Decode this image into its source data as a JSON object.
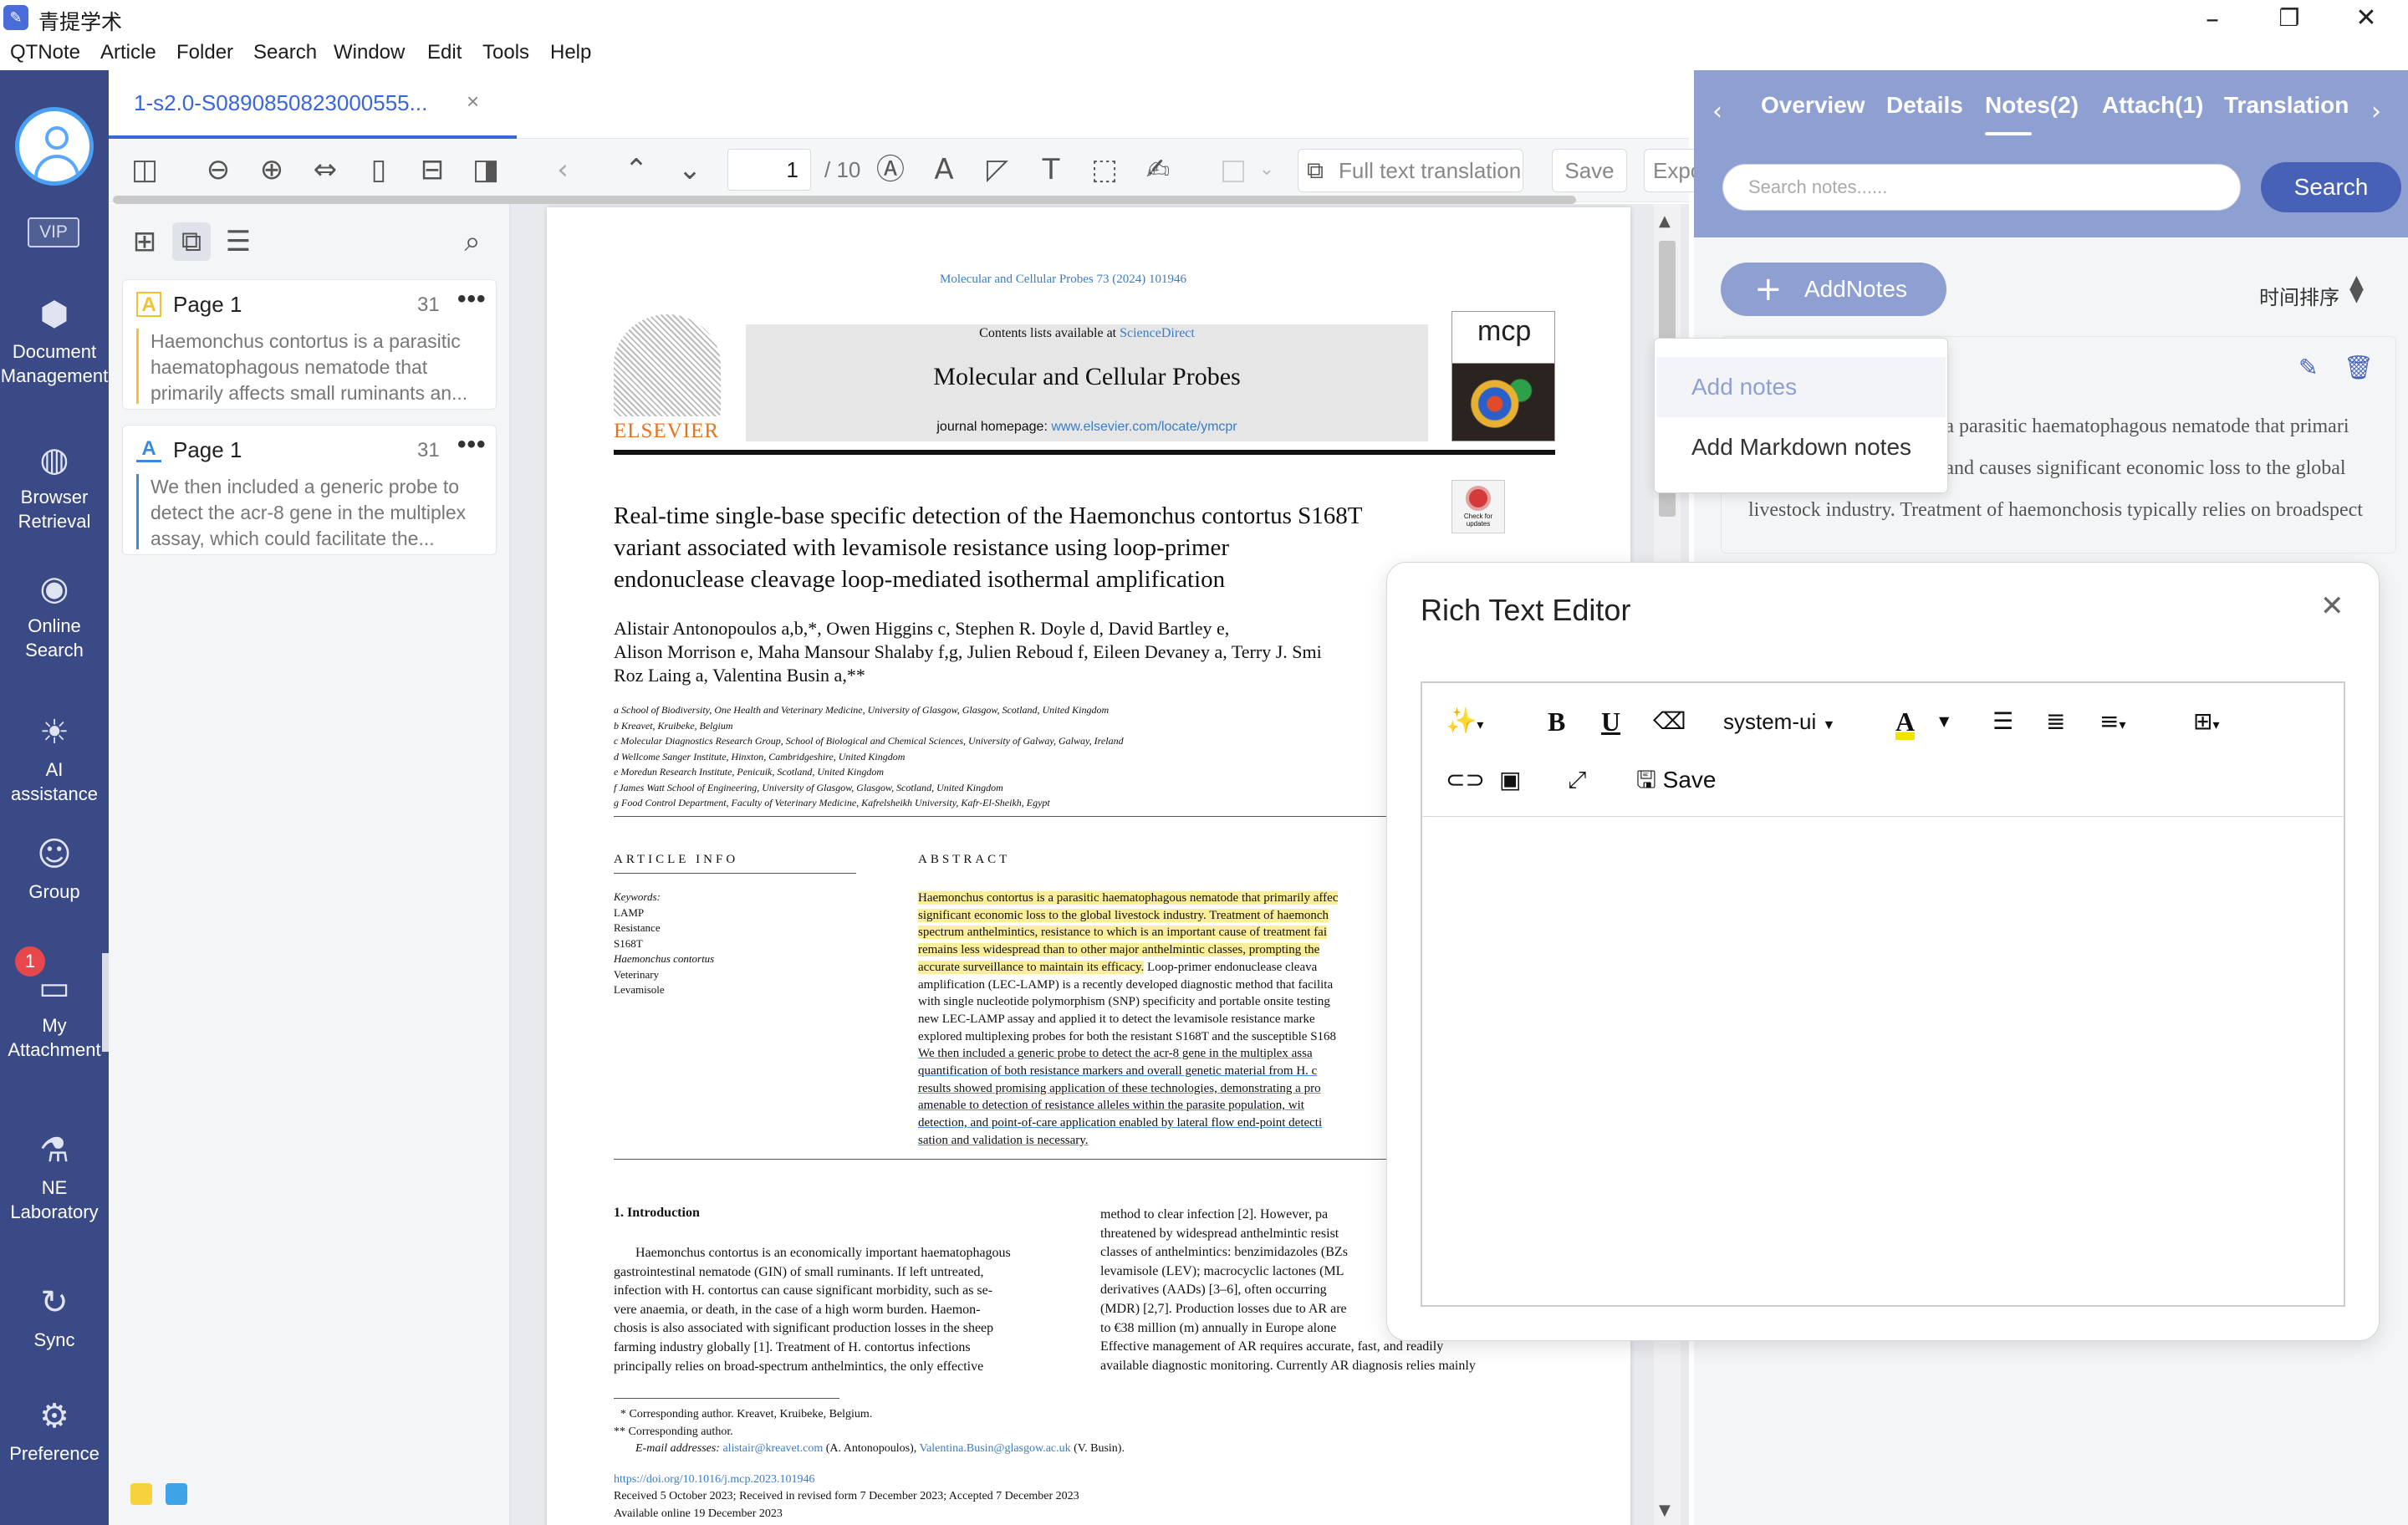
{
  "app": {
    "title": "青提学术",
    "logo_icon": "app-logo-icon",
    "window_controls": {
      "minimize": "–",
      "restore": "❐",
      "close": "✕"
    }
  },
  "menu": [
    "QTNote",
    "Article",
    "Folder",
    "Search",
    "Window",
    "Edit",
    "Tools",
    "Help"
  ],
  "nav": {
    "vip": "VIP",
    "items": [
      {
        "label_lines": [
          "Document",
          "Management"
        ],
        "icon": "cube-icon"
      },
      {
        "label_lines": [
          "Browser",
          "Retrieval"
        ],
        "icon": "globe-icon"
      },
      {
        "label_lines": [
          "Online",
          "Search"
        ],
        "icon": "eye-icon"
      },
      {
        "label_lines": [
          "AI assistance"
        ],
        "icon": "bulb-icon"
      },
      {
        "label_lines": [
          "Group"
        ],
        "icon": "group-icon"
      },
      {
        "label_lines": [
          "My",
          "Attachment"
        ],
        "icon": "folder-icon"
      },
      {
        "label_lines": [
          "NE",
          "Laboratory"
        ],
        "icon": "microscope-icon"
      },
      {
        "label_lines": [
          "Sync"
        ],
        "icon": "sync-icon"
      },
      {
        "label_lines": [
          "Preference"
        ],
        "icon": "gear-icon"
      }
    ],
    "attachment_badge": "1"
  },
  "doc_tab": {
    "label": "1-s2.0-S0890850823000555...",
    "close": "×"
  },
  "toolbar": {
    "page_current": "1",
    "page_total": "/ 10",
    "full_text_translation": "Full text translation",
    "save": "Save",
    "export": "Expo"
  },
  "annotations": [
    {
      "type": "highlight",
      "page": "Page 1",
      "count": "31",
      "more": "•••",
      "color": "#f2c230",
      "text": "Haemonchus contortus is a parasitic haematophagous nematode that primarily affects small ruminants an..."
    },
    {
      "type": "underline",
      "page": "Page 1",
      "count": "31",
      "more": "•••",
      "color": "#3a88e0",
      "text": "We then included a generic probe to detect the acr-8 gene in the multiplex assay, which could facilitate the..."
    }
  ],
  "paper": {
    "journal_line": "Molecular and Cellular Probes 73 (2024) 101946",
    "contents_prefix": "Contents lists available at ",
    "contents_link": "ScienceDirect",
    "journal_name": "Molecular and Cellular Probes",
    "homepage_prefix": "journal homepage: ",
    "homepage_link": "www.elsevier.com/locate/ymcpr",
    "publisher": "ELSEVIER",
    "cover_logo": "mcp",
    "check_updates": "Check for updates",
    "title_lines": [
      "Real-time single-base specific detection of the Haemonchus contortus S168T",
      "variant associated with levamisole resistance using loop-primer",
      "endonuclease cleavage loop-mediated isothermal amplification"
    ],
    "author_lines": [
      "Alistair Antonopoulos a,b,*, Owen Higgins c, Stephen R. Doyle d, David Bartley e,",
      "Alison Morrison e, Maha Mansour Shalaby f,g, Julien Reboud f, Eileen Devaney a, Terry J. Smi",
      "Roz Laing a, Valentina Busin a,**"
    ],
    "affiliations": [
      "a School of Biodiversity, One Health and Veterinary Medicine, University of Glasgow, Glasgow, Scotland, United Kingdom",
      "b Kreavet, Kruibeke, Belgium",
      "c Molecular Diagnostics Research Group, School of Biological and Chemical Sciences, University of Galway, Galway, Ireland",
      "d Wellcome Sanger Institute, Hinxton, Cambridgeshire, United Kingdom",
      "e Moredun Research Institute, Penicuik, Scotland, United Kingdom",
      "f James Watt School of Engineering, University of Glasgow, Glasgow, Scotland, United Kingdom",
      "g Food Control Department, Faculty of Veterinary Medicine, Kafrelsheikh University, Kafr-El-Sheikh, Egypt"
    ],
    "article_info_heading": "ARTICLE INFO",
    "abstract_heading": "ABSTRACT",
    "keywords_label": "Keywords:",
    "keywords": [
      "LAMP",
      "Resistance",
      "S168T",
      "Haemonchus contortus",
      "Veterinary",
      "Levamisole"
    ],
    "abstract_lines_highlight": [
      "Haemonchus contortus is a parasitic haematophagous nematode that primarily affec",
      "significant economic loss to the global livestock industry. Treatment of haemonch",
      "spectrum anthelmintics, resistance to which is an important cause of treatment fai",
      "remains less widespread than to other major anthelmintic classes, prompting the",
      "accurate surveillance to maintain its efficacy."
    ],
    "abstract_line5_rest": " Loop-primer endonuclease cleava",
    "abstract_lines_plain": [
      "amplification (LEC-LAMP) is a recently developed diagnostic method that facilita",
      "with single nucleotide polymorphism (SNP) specificity and portable onsite testing",
      "new LEC-LAMP assay and applied it to detect the levamisole resistance marke",
      "explored multiplexing probes for both the resistant S168T and the susceptible S168"
    ],
    "abstract_lines_underline": [
      "We then included a generic probe to detect the acr-8 gene in the multiplex assa",
      "quantification of both resistance markers and overall genetic material from H. c",
      "results showed promising application of these technologies, demonstrating a pro",
      "amenable to detection of resistance alleles within the parasite population, wit",
      "detection, and point-of-care application enabled by lateral flow end-point detecti",
      "sation and validation is necessary."
    ],
    "intro_heading": "1.  Introduction",
    "intro_left_lines": [
      "Haemonchus contortus is an economically important haematophagous",
      "gastrointestinal nematode (GIN) of small ruminants. If left untreated,",
      "infection with H. contortus can cause significant morbidity, such as se-",
      "vere anaemia, or death, in the case of a high worm burden. Haemon-",
      "chosis is also associated with significant production losses in the sheep",
      "farming industry globally [1]. Treatment of H. contortus infections",
      "principally relies on broad-spectrum anthelmintics, the only effective"
    ],
    "intro_right_lines": [
      "method to clear infection [2]. However, pa",
      "threatened by widespread anthelmintic resist",
      "classes of anthelmintics: benzimidazoles (BZs",
      "levamisole (LEV); macrocyclic lactones (ML",
      "derivatives (AADs) [3–6], often occurring",
      "(MDR) [2,7]. Production losses due to AR are",
      "to €38 million (m) annually in Europe alone",
      "    Effective management of AR requires accurate, fast, and readily",
      "available diagnostic monitoring. Currently AR diagnosis relies mainly"
    ],
    "footnotes": [
      "* Corresponding author. Kreavet, Kruibeke, Belgium.",
      "** Corresponding author."
    ],
    "email_prefix": "E-mail addresses: ",
    "email_1": "alistair@kreavet.com",
    "email_1_name": " (A. Antonopoulos), ",
    "email_2": "Valentina.Busin@glasgow.ac.uk",
    "email_2_name": " (V. Busin).",
    "doi": "https://doi.org/10.1016/j.mcp.2023.101946",
    "received": "Received 5 October 2023; Received in revised form 7 December 2023; Accepted 7 December 2023",
    "available": "Available online 19 December 2023"
  },
  "right_panel": {
    "tabs": [
      "Overview",
      "Details",
      "Notes(2)",
      "Attach(1)",
      "Translation"
    ],
    "active_tab": "Notes(2)",
    "search_placeholder": "Search notes......",
    "search_button": "Search",
    "add_notes": "AddNotes",
    "sort_label": "时间排序",
    "note_lines": [
      "s a parasitic haematophagous nematode that primari",
      "s and causes significant economic loss to the global",
      "livestock industry. Treatment of haemonchosis typically relies on broadspect"
    ]
  },
  "add_dropdown": {
    "items": [
      "Add notes",
      "Add Markdown notes"
    ]
  },
  "rich_text_editor": {
    "title": "Rich Text Editor",
    "font_select": "system-ui",
    "save": "Save"
  }
}
